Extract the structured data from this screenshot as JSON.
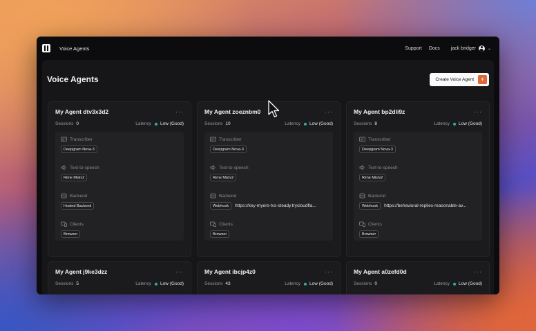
{
  "app": {
    "title": "Voice Agents"
  },
  "nav": {
    "support": "Support",
    "docs": "Docs",
    "user": "jack bridger"
  },
  "page": {
    "title": "Voice Agents",
    "create_label": "Create Voice Agent",
    "create_icon": "+"
  },
  "labels": {
    "sessions": "Sessions",
    "latency": "Latency",
    "transcriber": "Transcriber",
    "tts": "Text-to-speech",
    "backend": "Backend",
    "clients": "Clients",
    "more": "···"
  },
  "colors": {
    "accent": "#e0673a",
    "status_good": "#2bb3a6"
  },
  "agents": [
    {
      "name": "My Agent dtv3x3d2",
      "sessions": "0",
      "latency": "Low (Good)",
      "transcriber": "Deepgram Nova-3",
      "tts": "Rime Mistv2",
      "backend_type": "Hosted Backend",
      "backend_url": "",
      "client": "Browser"
    },
    {
      "name": "My Agent zoeznbm0",
      "sessions": "10",
      "latency": "Low (Good)",
      "transcriber": "Deepgram Nova-3",
      "tts": "Rime Mistv2",
      "backend_type": "Webhook",
      "backend_url": "https://key-myers-tvs-steady.trycloudfla...",
      "client": "Browser"
    },
    {
      "name": "My Agent bp2dli9z",
      "sessions": "8",
      "latency": "Low (Good)",
      "transcriber": "Deepgram Nova-3",
      "tts": "Rime Mistv2",
      "backend_type": "Webhook",
      "backend_url": "https://behavioral-replies-reasonable-av...",
      "client": "Browser"
    },
    {
      "name": "My Agent j9ke3dzz",
      "sessions": "5",
      "latency": "Low (Good)"
    },
    {
      "name": "My Agent ibcjp4z0",
      "sessions": "43",
      "latency": "Low (Good)"
    },
    {
      "name": "My Agent a0zefd0d",
      "sessions": "0",
      "latency": "Low (Good)"
    }
  ]
}
